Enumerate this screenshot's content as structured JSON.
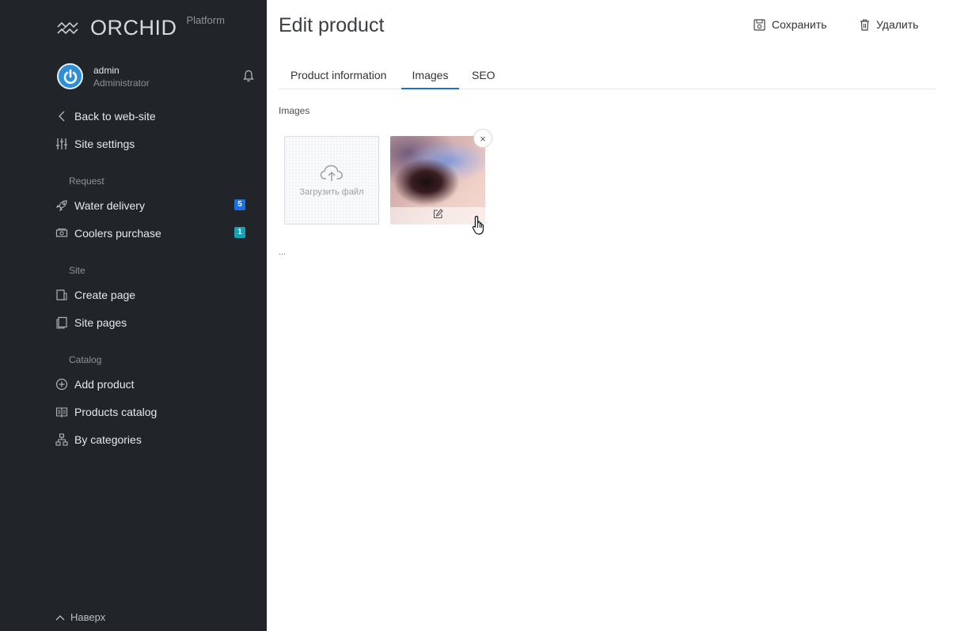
{
  "brand": {
    "name": "ORCHID",
    "subtitle": "Platform"
  },
  "profile": {
    "name": "admin",
    "role": "Administrator"
  },
  "sidebar": {
    "nav": [
      {
        "label": "Back to web-site",
        "icon": "chevron-left-icon"
      },
      {
        "label": "Site settings",
        "icon": "sliders-icon"
      }
    ],
    "sections": [
      {
        "title": "Request",
        "items": [
          {
            "label": "Water delivery",
            "icon": "rocket-icon",
            "badge": "5",
            "badge_color": "#1a6fe6"
          },
          {
            "label": "Coolers purchase",
            "icon": "money-icon",
            "badge": "1",
            "badge_color": "#1a9fb3"
          }
        ]
      },
      {
        "title": "Site",
        "items": [
          {
            "label": "Create page",
            "icon": "page-add-icon"
          },
          {
            "label": "Site pages",
            "icon": "pages-icon"
          }
        ]
      },
      {
        "title": "Catalog",
        "items": [
          {
            "label": "Add product",
            "icon": "plus-circle-icon"
          },
          {
            "label": "Products catalog",
            "icon": "book-icon"
          },
          {
            "label": "By categories",
            "icon": "hierarchy-icon"
          }
        ]
      }
    ],
    "to_top": "Наверх"
  },
  "main": {
    "title": "Edit product",
    "actions": {
      "save": "Сохранить",
      "delete": "Удалить"
    },
    "tabs": [
      {
        "label": "Product information",
        "active": false
      },
      {
        "label": "Images",
        "active": true
      },
      {
        "label": "SEO",
        "active": false
      }
    ],
    "field_label": "Images",
    "upload_text": "Загрузить файл",
    "close_symbol": "×",
    "ellipsis": "..."
  },
  "colors": {
    "sidebar_bg": "#212529",
    "accent": "#1c6fd1"
  }
}
